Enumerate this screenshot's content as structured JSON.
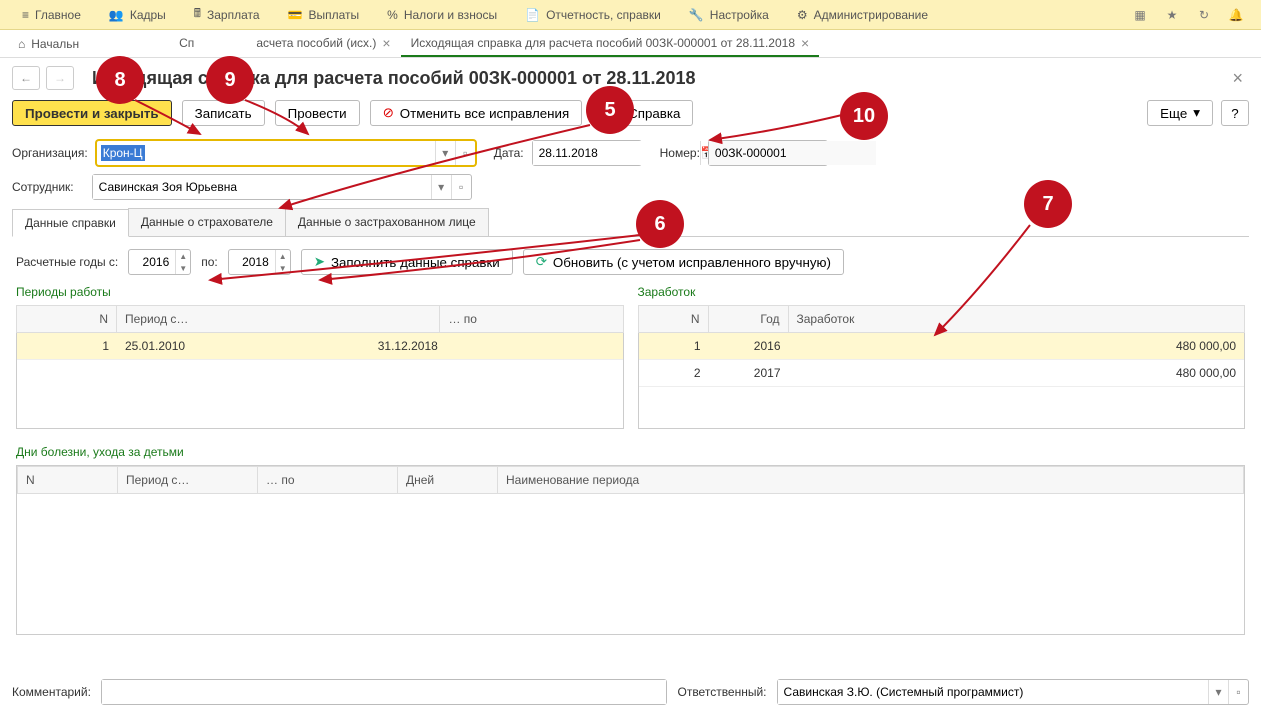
{
  "top_menu": {
    "items": [
      {
        "label": "Главное"
      },
      {
        "label": "Кадры"
      },
      {
        "label": "Зарплата"
      },
      {
        "label": "Выплаты"
      },
      {
        "label": "Налоги и взносы"
      },
      {
        "label": "Отчетность, справки"
      },
      {
        "label": "Настройка"
      },
      {
        "label": "Администрирование"
      }
    ]
  },
  "breadcrumbs": {
    "items": [
      {
        "label": "Начальн"
      },
      {
        "label": "асчета пособий (исх.)"
      },
      {
        "label": "Исходящая справка для расчета пособий 00ЗК-000001 от 28.11.2018"
      }
    ]
  },
  "page": {
    "title": "Исходящая справка для расчета пособий 00ЗК-000001 от 28.11.2018"
  },
  "toolbar": {
    "post_close": "Провести и закрыть",
    "write": "Записать",
    "post": "Провести",
    "cancel_fix": "Отменить все исправления",
    "help_doc": "Справка",
    "more": "Еще",
    "help": "?"
  },
  "form": {
    "org_label": "Организация:",
    "org_value": "Крон-Ц",
    "date_label": "Дата:",
    "date_value": "28.11.2018",
    "num_label": "Номер:",
    "num_value": "00ЗК-000001",
    "emp_label": "Сотрудник:",
    "emp_value": "Савинская Зоя Юрьевна"
  },
  "tabs": {
    "t1": "Данные справки",
    "t2": "Данные о страхователе",
    "t3": "Данные о застрахованном лице"
  },
  "years": {
    "label_from": "Расчетные годы с:",
    "year_from": "2016",
    "label_to": "по:",
    "year_to": "2018",
    "fill": "Заполнить данные справки",
    "refresh": "Обновить (с учетом исправленного вручную)"
  },
  "periods": {
    "title": "Периоды работы",
    "cols": {
      "n": "N",
      "from": "Период с…",
      "to": "… по"
    },
    "rows": [
      {
        "n": "1",
        "from": "25.01.2010",
        "to": "31.12.2018"
      }
    ]
  },
  "earnings": {
    "title": "Заработок",
    "cols": {
      "n": "N",
      "year": "Год",
      "amount": "Заработок"
    },
    "rows": [
      {
        "n": "1",
        "year": "2016",
        "amount": "480 000,00"
      },
      {
        "n": "2",
        "year": "2017",
        "amount": "480 000,00"
      }
    ]
  },
  "sick": {
    "title": "Дни болезни, ухода за детьми",
    "cols": {
      "n": "N",
      "from": "Период с…",
      "to": "… по",
      "days": "Дней",
      "name": "Наименование периода"
    }
  },
  "footer": {
    "comment_label": "Комментарий:",
    "comment_value": "",
    "resp_label": "Ответственный:",
    "resp_value": "Савинская З.Ю. (Системный программист)"
  },
  "annotations": {
    "a5": "5",
    "a6": "6",
    "a7": "7",
    "a8": "8",
    "a9": "9",
    "a10": "10"
  }
}
